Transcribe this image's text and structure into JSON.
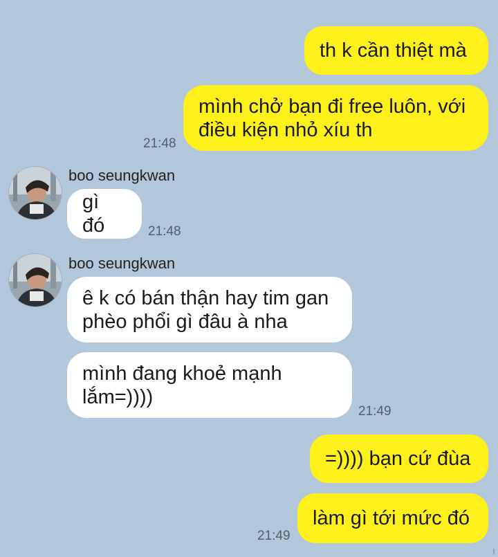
{
  "messages": [
    {
      "text": "th k cần thiệt mà"
    },
    {
      "text": "mình chở bạn đi free luôn, với\nđiều kiện nhỏ xíu th",
      "time": "21:48"
    },
    {
      "sender": "boo seungkwan",
      "text": "gì đó",
      "time": "21:48"
    },
    {
      "sender": "boo seungkwan",
      "text": "ê k có bán thận hay tim gan\nphèo phổi gì đâu à nha"
    },
    {
      "text": "mình đang khoẻ mạnh\nlắm=))))",
      "time": "21:49"
    },
    {
      "text": "=)))) bạn cứ đùa"
    },
    {
      "text": "làm gì tới mức đó",
      "time": "21:49"
    }
  ],
  "colors": {
    "background": "#b2c7da",
    "my_bubble": "#fef01b",
    "their_bubble": "#ffffff"
  },
  "icons": {
    "avatar": "profile-photo-avatar-icon"
  }
}
